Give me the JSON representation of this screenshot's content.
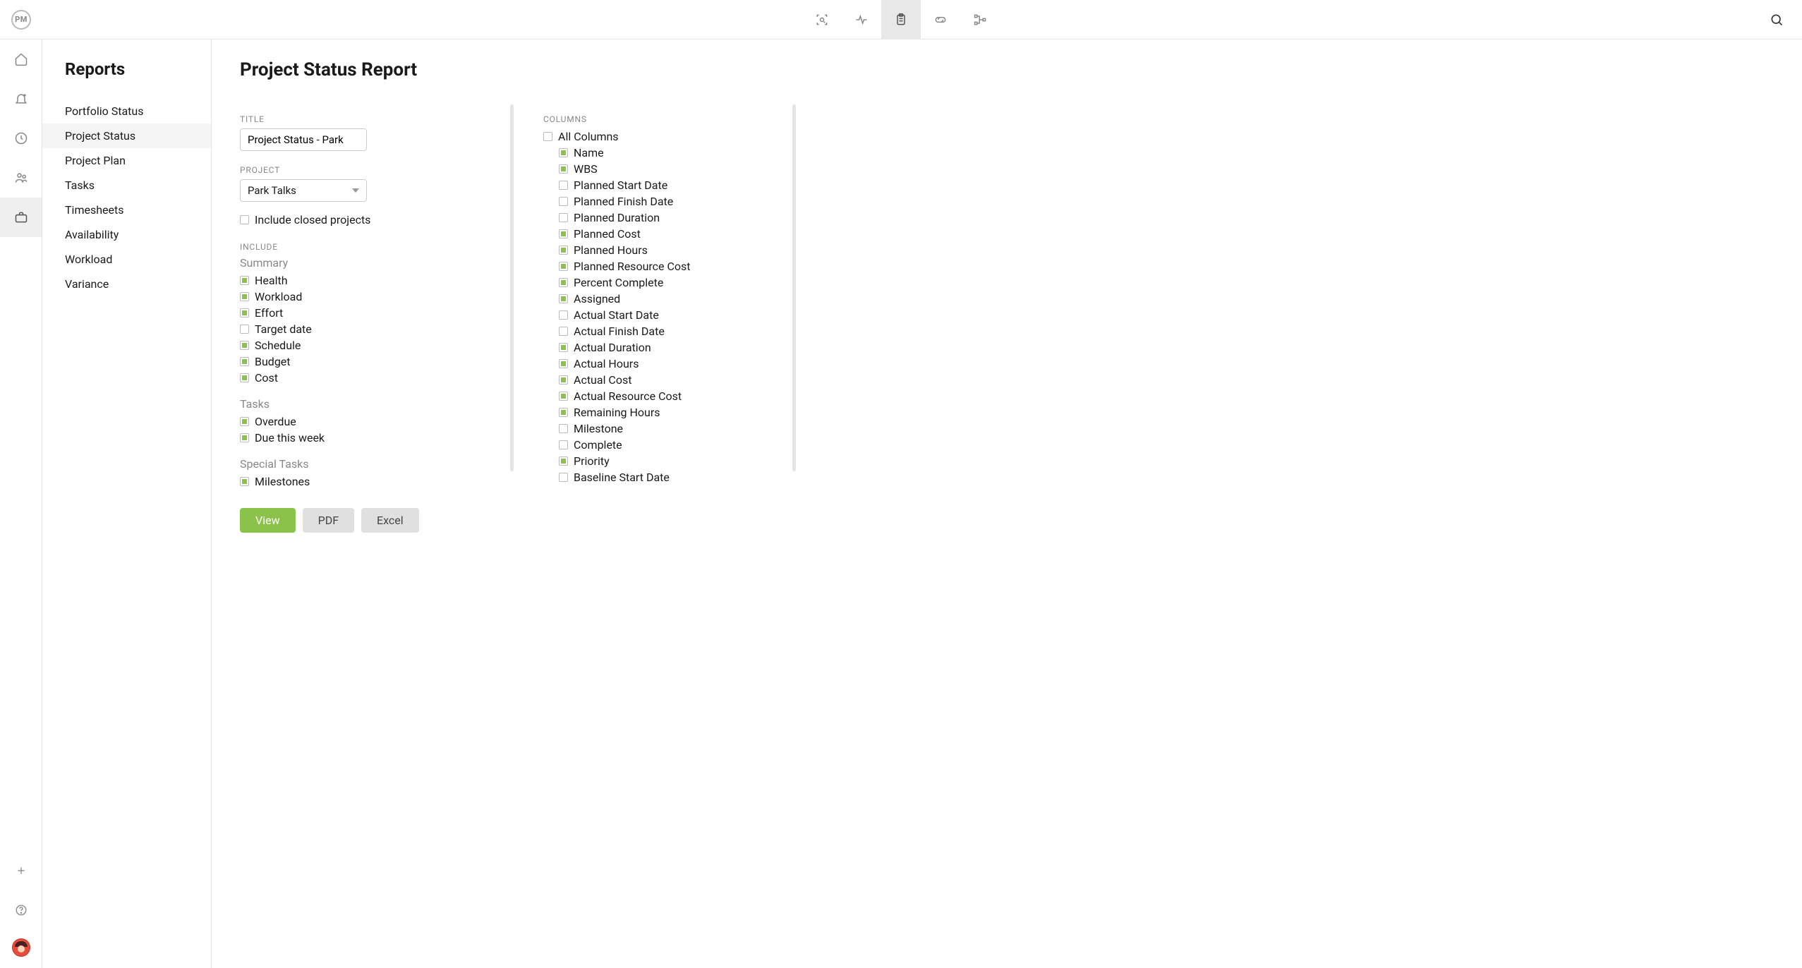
{
  "logo_text": "PM",
  "topbar": {
    "icons": [
      {
        "name": "scan-icon"
      },
      {
        "name": "activity-icon"
      },
      {
        "name": "clipboard-icon",
        "active": true
      },
      {
        "name": "link-icon"
      },
      {
        "name": "flow-icon"
      }
    ],
    "search_name": "search-icon"
  },
  "left_rail": {
    "items": [
      {
        "name": "home-icon"
      },
      {
        "name": "bell-icon"
      },
      {
        "name": "clock-icon"
      },
      {
        "name": "people-icon"
      },
      {
        "name": "briefcase-icon",
        "active": true
      }
    ],
    "bottom": [
      {
        "name": "plus-icon"
      },
      {
        "name": "help-icon"
      },
      {
        "name": "avatar"
      }
    ]
  },
  "sidebar": {
    "title": "Reports",
    "items": [
      {
        "label": "Portfolio Status"
      },
      {
        "label": "Project Status",
        "active": true
      },
      {
        "label": "Project Plan"
      },
      {
        "label": "Tasks"
      },
      {
        "label": "Timesheets"
      },
      {
        "label": "Availability"
      },
      {
        "label": "Workload"
      },
      {
        "label": "Variance"
      }
    ]
  },
  "main": {
    "title": "Project Status Report",
    "labels": {
      "title": "TITLE",
      "project": "PROJECT",
      "include_closed": "Include closed projects",
      "include": "INCLUDE",
      "summary": "Summary",
      "tasks": "Tasks",
      "special_tasks": "Special Tasks",
      "columns": "COLUMNS",
      "all_columns": "All Columns"
    },
    "title_value": "Project Status - Park",
    "project_value": "Park Talks",
    "include_closed_checked": false,
    "summary_items": [
      {
        "label": "Health",
        "checked": true
      },
      {
        "label": "Workload",
        "checked": true
      },
      {
        "label": "Effort",
        "checked": true
      },
      {
        "label": "Target date",
        "checked": false
      },
      {
        "label": "Schedule",
        "checked": true
      },
      {
        "label": "Budget",
        "checked": true
      },
      {
        "label": "Cost",
        "checked": true
      }
    ],
    "task_items": [
      {
        "label": "Overdue",
        "checked": true
      },
      {
        "label": "Due this week",
        "checked": true
      }
    ],
    "special_items": [
      {
        "label": "Milestones",
        "checked": true
      }
    ],
    "all_columns_checked": false,
    "columns": [
      {
        "label": "Name",
        "checked": true
      },
      {
        "label": "WBS",
        "checked": true
      },
      {
        "label": "Planned Start Date",
        "checked": false
      },
      {
        "label": "Planned Finish Date",
        "checked": false
      },
      {
        "label": "Planned Duration",
        "checked": false
      },
      {
        "label": "Planned Cost",
        "checked": true
      },
      {
        "label": "Planned Hours",
        "checked": true
      },
      {
        "label": "Planned Resource Cost",
        "checked": true
      },
      {
        "label": "Percent Complete",
        "checked": true
      },
      {
        "label": "Assigned",
        "checked": true
      },
      {
        "label": "Actual Start Date",
        "checked": false
      },
      {
        "label": "Actual Finish Date",
        "checked": false
      },
      {
        "label": "Actual Duration",
        "checked": true
      },
      {
        "label": "Actual Hours",
        "checked": true
      },
      {
        "label": "Actual Cost",
        "checked": true
      },
      {
        "label": "Actual Resource Cost",
        "checked": true
      },
      {
        "label": "Remaining Hours",
        "checked": true
      },
      {
        "label": "Milestone",
        "checked": false
      },
      {
        "label": "Complete",
        "checked": false
      },
      {
        "label": "Priority",
        "checked": true
      },
      {
        "label": "Baseline Start Date",
        "checked": false
      }
    ],
    "buttons": {
      "view": "View",
      "pdf": "PDF",
      "excel": "Excel"
    }
  }
}
